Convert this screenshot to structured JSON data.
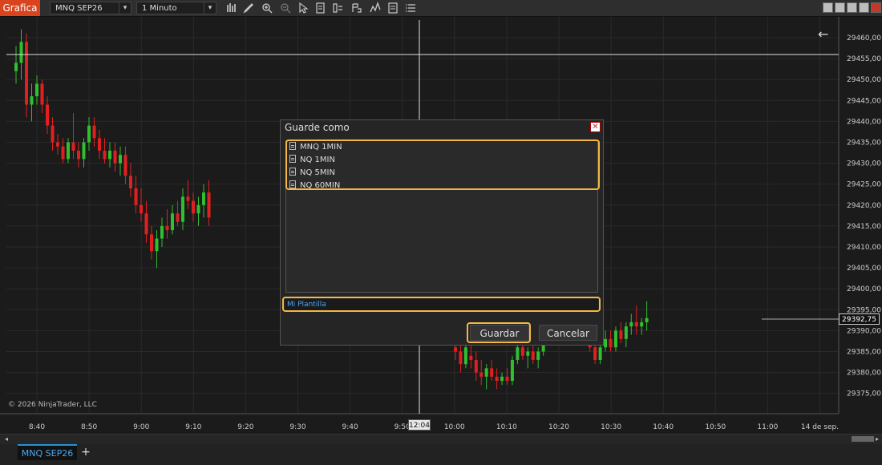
{
  "toolbar": {
    "app_tab": "Grafica",
    "instrument": "MNQ SEP26",
    "timeframe": "1 Minuto",
    "icons": [
      "bar-type-icon",
      "draw-pencil-icon",
      "zoom-in-icon",
      "zoom-out-icon",
      "pointer-icon",
      "properties-icon",
      "indicators-icon",
      "strategies-icon",
      "chart-trader-icon",
      "templates-icon",
      "menu-icon"
    ]
  },
  "chart": {
    "copyright": "© 2026 NinjaTrader, LLC",
    "crosshair_time": "12:04",
    "last_price": "29392,75",
    "price_labels": [
      "29460,00",
      "29455,00",
      "29450,00",
      "29445,00",
      "29440,00",
      "29435,00",
      "29430,00",
      "29425,00",
      "29420,00",
      "29415,00",
      "29410,00",
      "29405,00",
      "29400,00",
      "29395,00",
      "29390,00",
      "29385,00",
      "29380,00",
      "29375,00"
    ],
    "time_labels": [
      "8:40",
      "8:50",
      "9:00",
      "9:10",
      "9:20",
      "9:30",
      "9:40",
      "9:50",
      "10:00",
      "10:10",
      "10:20",
      "10:30",
      "10:40",
      "10:50",
      "11:00",
      "14 de sep."
    ],
    "colors": {
      "up": "#2fbf2f",
      "down": "#e02020",
      "grid": "#2a2a2a",
      "axis_text": "#cccccc"
    }
  },
  "chart_data": {
    "type": "candlestick",
    "ylim": [
      29372,
      29463
    ],
    "candles": [
      [
        29452,
        29458,
        29449,
        29454
      ],
      [
        29454,
        29462,
        29450,
        29459
      ],
      [
        29459,
        29461,
        29441,
        29444
      ],
      [
        29444,
        29449,
        29440,
        29446
      ],
      [
        29446,
        29451,
        29444,
        29449
      ],
      [
        29449,
        29450,
        29442,
        29444
      ],
      [
        29444,
        29446,
        29437,
        29439
      ],
      [
        29439,
        29441,
        29433,
        29435
      ],
      [
        29435,
        29437,
        29432,
        29434
      ],
      [
        29434,
        29436,
        29430,
        29431
      ],
      [
        29431,
        29436,
        29430,
        29435
      ],
      [
        29435,
        29442,
        29431,
        29433
      ],
      [
        29433,
        29435,
        29429,
        29431
      ],
      [
        29431,
        29436,
        29429,
        29435
      ],
      [
        29435,
        29441,
        29433,
        29439
      ],
      [
        29439,
        29441,
        29434,
        29436
      ],
      [
        29436,
        29438,
        29431,
        29433
      ],
      [
        29433,
        29436,
        29430,
        29431
      ],
      [
        29431,
        29435,
        29429,
        29433
      ],
      [
        29433,
        29435,
        29428,
        29430
      ],
      [
        29430,
        29434,
        29427,
        29432
      ],
      [
        29432,
        29434,
        29425,
        29427
      ],
      [
        29427,
        29430,
        29422,
        29424
      ],
      [
        29424,
        29427,
        29418,
        29420
      ],
      [
        29420,
        29424,
        29416,
        29418
      ],
      [
        29418,
        29421,
        29411,
        29413
      ],
      [
        29413,
        29415,
        29407,
        29409
      ],
      [
        29409,
        29414,
        29405,
        29412
      ],
      [
        29412,
        29417,
        29410,
        29415
      ],
      [
        29415,
        29419,
        29412,
        29414
      ],
      [
        29414,
        29420,
        29413,
        29418
      ],
      [
        29418,
        29421,
        29415,
        29416
      ],
      [
        29416,
        29424,
        29414,
        29422
      ],
      [
        29422,
        29426,
        29419,
        29421
      ],
      [
        29421,
        29423,
        29416,
        29418
      ],
      [
        29418,
        29422,
        29415,
        29420
      ],
      [
        29420,
        29425,
        29417,
        29423
      ],
      [
        29423,
        29426,
        29415,
        29417
      ],
      [
        29386,
        29391,
        29383,
        29385
      ],
      [
        29385,
        29388,
        29380,
        29382
      ],
      [
        29382,
        29387,
        29381,
        29386
      ],
      [
        29384,
        29387,
        29381,
        29383
      ],
      [
        29383,
        29385,
        29378,
        29380
      ],
      [
        29380,
        29383,
        29377,
        29379
      ],
      [
        29379,
        29382,
        29376,
        29381
      ],
      [
        29381,
        29383,
        29378,
        29379
      ],
      [
        29379,
        29381,
        29376,
        29378
      ],
      [
        29378,
        29380,
        29377,
        29379
      ],
      [
        29379,
        29381,
        29377,
        29378
      ],
      [
        29378,
        29384,
        29377,
        29383
      ],
      [
        29383,
        29387,
        29382,
        29386
      ],
      [
        29386,
        29388,
        29383,
        29384
      ],
      [
        29384,
        29386,
        29381,
        29385
      ],
      [
        29385,
        29387,
        29382,
        29383
      ],
      [
        29383,
        29386,
        29381,
        29385
      ],
      [
        29385,
        29389,
        29384,
        29388
      ],
      [
        29388,
        29395,
        29387,
        29393
      ],
      [
        29393,
        29395,
        29389,
        29390
      ],
      [
        29390,
        29392,
        29388,
        29389
      ],
      [
        29389,
        29391,
        29388,
        29390
      ],
      [
        29390,
        29395,
        29389,
        29393
      ],
      [
        29393,
        29397,
        29392,
        29395
      ],
      [
        29395,
        29396,
        29391,
        29392
      ],
      [
        29392,
        29394,
        29388,
        29389
      ],
      [
        29389,
        29391,
        29385,
        29386
      ],
      [
        29386,
        29389,
        29382,
        29383
      ],
      [
        29383,
        29387,
        29382,
        29386
      ],
      [
        29386,
        29390,
        29385,
        29388
      ],
      [
        29388,
        29390,
        29385,
        29386
      ],
      [
        29386,
        29391,
        29385,
        29390
      ],
      [
        29390,
        29392,
        29387,
        29388
      ],
      [
        29388,
        29392,
        29386,
        29391
      ],
      [
        29391,
        29394,
        29389,
        29392
      ],
      [
        29392,
        29396,
        29389,
        29391
      ],
      [
        29391,
        29393,
        29389,
        29392
      ],
      [
        29392,
        29397,
        29390,
        29393
      ]
    ]
  },
  "dialog": {
    "title": "Guarde como",
    "items": [
      "MNQ 1MIN",
      "NQ 1MIN",
      "NQ 5MIN",
      "NQ 60MIN"
    ],
    "input_value": "Mi Plantilla",
    "save_label": "Guardar",
    "cancel_label": "Cancelar",
    "close_glyph": "✕"
  },
  "tabs": {
    "active": "MNQ SEP26",
    "add": "+"
  },
  "scrollbar": {
    "left_glyph": "◂",
    "right_glyph": "▸"
  },
  "back_glyph": "←"
}
